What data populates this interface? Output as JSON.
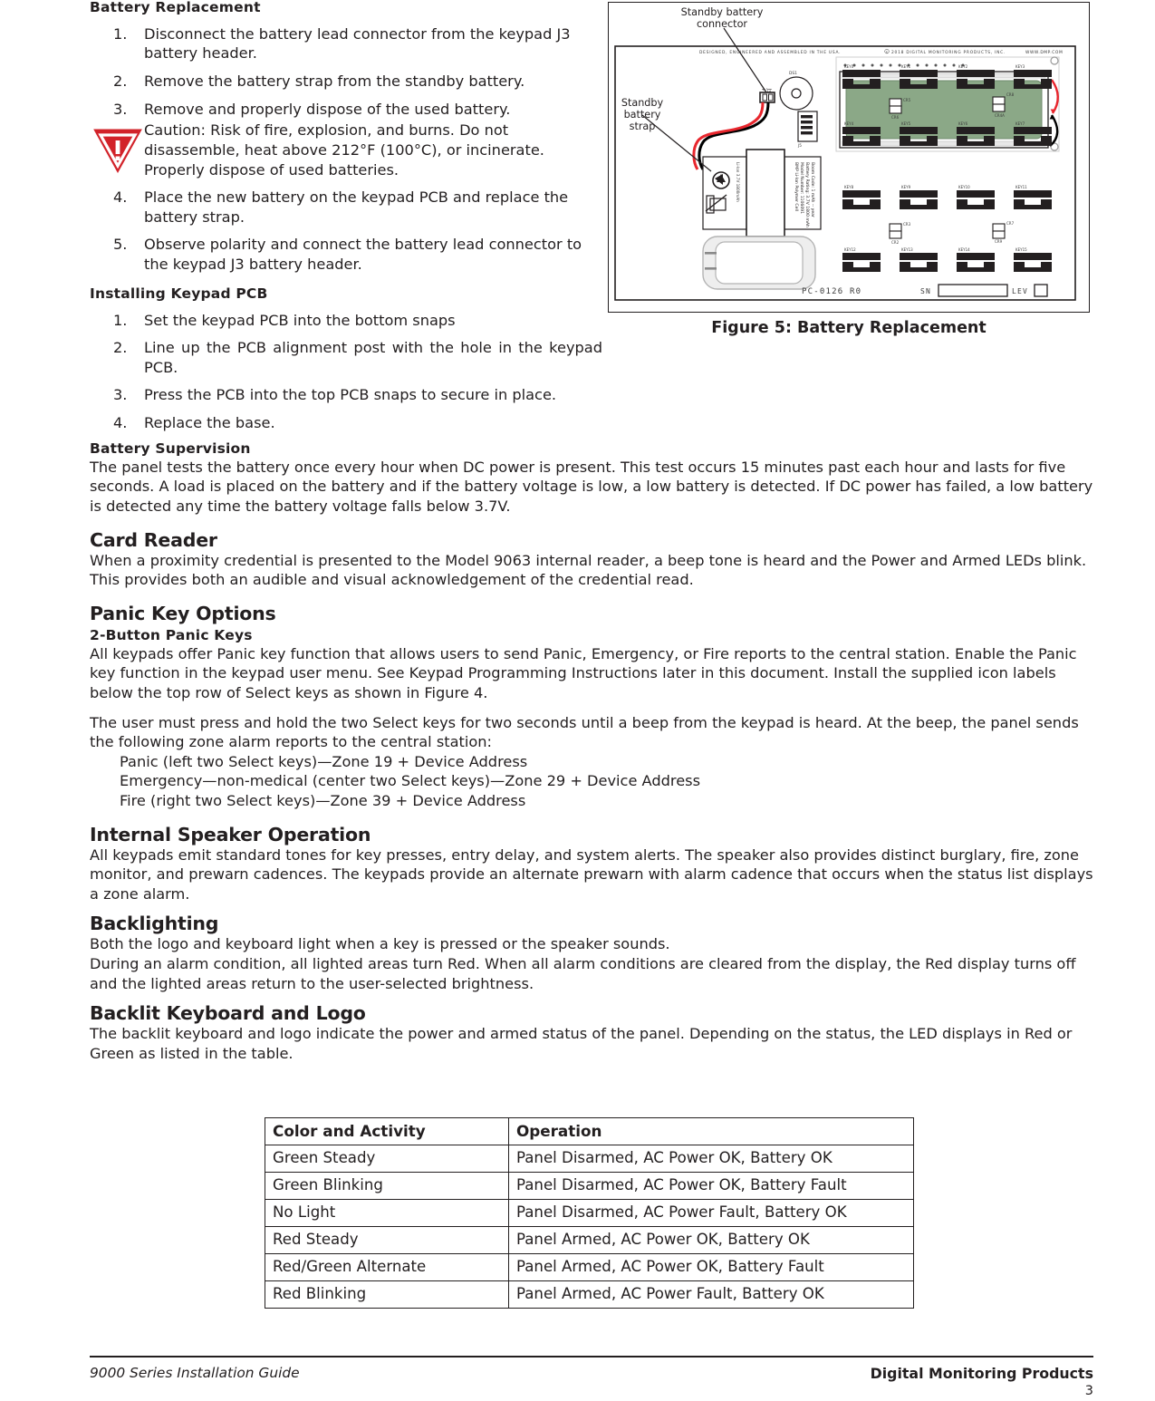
{
  "document": {
    "footer_left": "9000 Series Installation Guide",
    "footer_right": "Digital Monitoring Products",
    "page_number": "3"
  },
  "battery_replacement": {
    "heading": "Battery Replacement",
    "steps": [
      {
        "num": "1.",
        "text": "Disconnect the battery lead connector from the keypad J3 battery header."
      },
      {
        "num": "2.",
        "text": "Remove the battery strap from the standby battery."
      },
      {
        "num": "3.",
        "text": "Remove and properly dispose of the used battery."
      }
    ],
    "caution": "Caution: Risk of fire, explosion, and burns.  Do not disassemble, heat above 212°F (100°C), or incinerate. Properly dispose of used batteries.",
    "steps_after": [
      {
        "num": "4.",
        "text": "Place the new battery on the keypad PCB and replace the battery strap."
      },
      {
        "num": "5.",
        "text": "Observe polarity and connect the battery lead connector to the keypad J3 battery header."
      }
    ]
  },
  "installing_keypad_pcb": {
    "heading": "Installing Keypad PCB",
    "steps": [
      {
        "num": "1.",
        "text": "Set the keypad PCB into the bottom snaps"
      },
      {
        "num": "2.",
        "text": "Line up the PCB alignment post with the hole in the keypad PCB."
      },
      {
        "num": "3.",
        "text": "Press the PCB into the top PCB snaps to secure in place."
      },
      {
        "num": "4.",
        "text": "Replace the base."
      }
    ]
  },
  "figure": {
    "caption": "Figure 5: Battery Replacement",
    "label_connector": "Standby battery\nconnector",
    "label_strap": "Standby\nbattery\nstrap",
    "pcb_silkscreen_left": "DESIGNED, ENGINEERED AND ASSEMBLED IN THE USA.",
    "pcb_silkscreen_right": "© 2018  DIGITAL  MONITORING  PRODUCTS,  INC.",
    "pcb_silkscreen_url": "WWW.DMP.COM",
    "pcb_part": "PC-0126  R0",
    "pcb_sn": "SN",
    "pcb_lev": "LEV",
    "connector_ref": "J3",
    "connector_plus": "+",
    "connector_minus": "−",
    "buzzer_ref": "DS1",
    "header_ref": "J5",
    "battery_label": "BMP Li-Ion Polymer Cell\nModel Number: 1106091\nBattery Rating: 3.7V 1800 mAh\nBoom Code: 1 mAh -- year",
    "key_labels": [
      "KEY0",
      "KEY1",
      "KEY2",
      "KEY3",
      "KEY4",
      "KEY5",
      "KEY6",
      "KEY7",
      "KEY8",
      "KEY9",
      "KEY10",
      "KEY11",
      "KEY12",
      "KEY13",
      "KEY14",
      "KEY15"
    ],
    "lcd_color": "#8ba887",
    "wire_red": "#e8262d",
    "wire_black": "#000000",
    "caution_icon_color": "#d2232a"
  },
  "battery_supervision": {
    "heading": "Battery Supervision",
    "body": "The panel tests the battery once every hour when DC power is present.  This test occurs 15 minutes past each hour and lasts for five seconds.  A load is placed on the battery and if the battery voltage is low, a low battery is detected.  If DC power has failed, a low battery is detected any time the battery voltage falls below 3.7V."
  },
  "card_reader": {
    "heading": "Card Reader",
    "body": "When a proximity credential is presented to the Model 9063 internal reader, a beep tone is heard and the Power and Armed LEDs blink.  This provides both an audible and visual acknowledgement of the credential read."
  },
  "panic_key_options": {
    "heading": "Panic Key Options",
    "subheading": "2-Button Panic Keys",
    "body1": "All keypads offer Panic key function that allows users to send Panic, Emergency, or Fire reports to the central station. Enable the Panic key function in the keypad user menu.  See Keypad Programming Instructions later in this document. Install the supplied icon labels below the top row of Select keys as shown in Figure 4.",
    "body2": "The user must press and hold the two Select keys for two seconds until a beep from the keypad is heard.  At the beep, the panel sends the following zone alarm reports to the central station:",
    "list": [
      "Panic (left two Select keys)—Zone 19 + Device Address",
      "Emergency—non-medical (center two Select keys)—Zone 29 + Device Address",
      "Fire (right two Select keys)—Zone 39 + Device Address"
    ]
  },
  "internal_speaker": {
    "heading": "Internal Speaker Operation",
    "body": "All keypads emit standard tones for key presses, entry delay, and system alerts.  The speaker also provides distinct burglary, fire, zone monitor, and prewarn cadences.  The keypads provide an alternate prewarn with alarm cadence that occurs when the status list displays a zone alarm."
  },
  "backlighting": {
    "heading": "Backlighting",
    "body1": "Both the logo and keyboard light when a key is pressed or the speaker sounds.",
    "body2": "During an alarm condition, all lighted areas turn Red.  When all alarm conditions are cleared from the display, the Red display turns off and the lighted areas return to the user-selected brightness."
  },
  "backlit_keyboard": {
    "heading": "Backlit Keyboard and Logo",
    "body": "The backlit keyboard and logo indicate the power and armed status of the panel.  Depending on the status, the LED displays in Red or Green as listed in the table.",
    "table": {
      "headers": [
        "Color and Activity",
        "Operation"
      ],
      "rows": [
        [
          "Green Steady",
          "Panel Disarmed, AC Power OK, Battery OK"
        ],
        [
          "Green Blinking",
          "Panel Disarmed, AC Power OK, Battery Fault"
        ],
        [
          "No Light",
          "Panel Disarmed, AC Power Fault, Battery OK"
        ],
        [
          "Red Steady",
          "Panel Armed, AC Power OK, Battery OK"
        ],
        [
          "Red/Green Alternate",
          "Panel Armed, AC Power OK, Battery Fault"
        ],
        [
          "Red Blinking",
          "Panel Armed, AC Power Fault, Battery OK"
        ]
      ]
    }
  }
}
